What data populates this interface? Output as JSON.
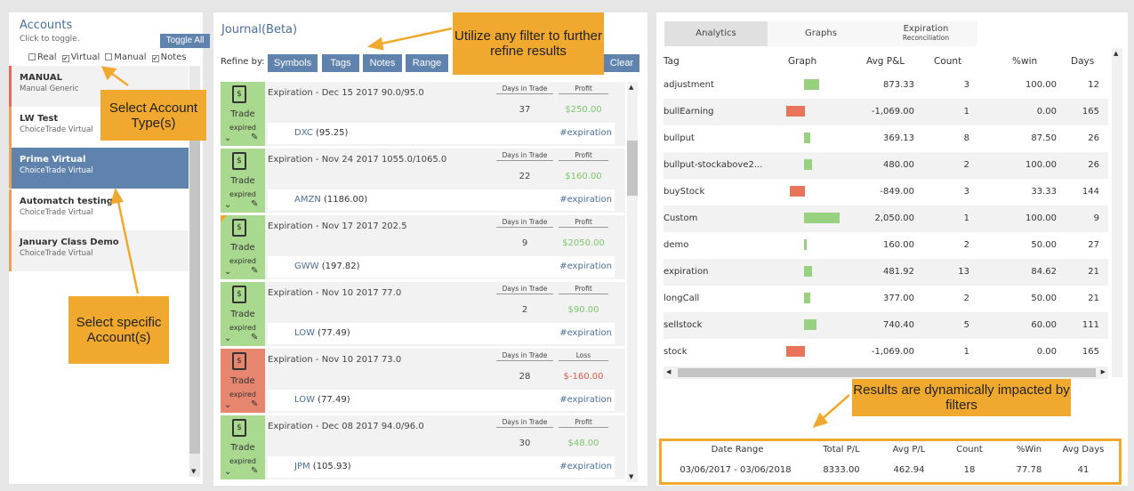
{
  "accounts": {
    "title": "Accounts",
    "subtitle": "Click to toggle.",
    "toggle_all": "Toggle All",
    "filters": [
      {
        "label": "Real",
        "checked": false
      },
      {
        "label": "Virtual",
        "checked": true
      },
      {
        "label": "Manual",
        "checked": false
      },
      {
        "label": "Notes",
        "checked": true
      }
    ],
    "items": [
      {
        "name": "MANUAL",
        "type": "Manual Generic"
      },
      {
        "name": "LW Test",
        "type": "ChoiceTrade Virtual"
      },
      {
        "name": "Prime Virtual",
        "type": "ChoiceTrade Virtual"
      },
      {
        "name": "Automatch testing",
        "type": "ChoiceTrade Virtual"
      },
      {
        "name": "January Class Demo",
        "type": "ChoiceTrade Virtual"
      }
    ]
  },
  "journal": {
    "title": "Journal(Beta)",
    "refine_label": "Refine by:",
    "filters": [
      "Symbols",
      "Tags",
      "Notes",
      "Range"
    ],
    "clear": "Clear",
    "days_label": "Days in Trade",
    "trades": [
      {
        "desc": "Expiration - Dec 15 2017 90.0/95.0",
        "days": "37",
        "pl_label": "Profit",
        "amount": "$250.00",
        "symbol": "DXC",
        "price": "(95.25)",
        "tag": "#expiration",
        "status": "Trade",
        "sub": "expired",
        "result": "profit"
      },
      {
        "desc": "Expiration - Nov 24 2017 1055.0/1065.0",
        "days": "22",
        "pl_label": "Profit",
        "amount": "$160.00",
        "symbol": "AMZN",
        "price": "(1186.00)",
        "tag": "#expiration",
        "status": "Trade",
        "sub": "expired",
        "result": "profit"
      },
      {
        "desc": "Expiration - Nov 17 2017 202.5",
        "days": "9",
        "pl_label": "Profit",
        "amount": "$2050.00",
        "symbol": "GWW",
        "price": "(197.82)",
        "tag": "#expiration",
        "status": "Trade",
        "sub": "expired",
        "result": "profit"
      },
      {
        "desc": "Expiration - Nov 10 2017 77.0",
        "days": "2",
        "pl_label": "Profit",
        "amount": "$90.00",
        "symbol": "LOW",
        "price": "(77.49)",
        "tag": "#expiration",
        "status": "Trade",
        "sub": "expired",
        "result": "profit"
      },
      {
        "desc": "Expiration - Nov 10 2017 73.0",
        "days": "28",
        "pl_label": "Loss",
        "amount": "$-160.00",
        "symbol": "LOW",
        "price": "(77.49)",
        "tag": "#expiration",
        "status": "Trade",
        "sub": "expired",
        "result": "loss"
      },
      {
        "desc": "Expiration - Dec 08 2017 94.0/96.0",
        "days": "30",
        "pl_label": "Profit",
        "amount": "$48.00",
        "symbol": "JPM",
        "price": "(105.93)",
        "tag": "#expiration",
        "status": "Trade",
        "sub": "expired",
        "result": "profit"
      }
    ]
  },
  "analytics": {
    "tabs": [
      "Analytics",
      "Graphs",
      "Expiration",
      "Reconciliation"
    ],
    "columns": [
      "Tag",
      "Graph",
      "Avg P&L",
      "Count",
      "%win",
      "Days"
    ],
    "rows": [
      {
        "tag": "adjustment",
        "avg": "873.33",
        "count": "3",
        "win": "100.00",
        "days": "12",
        "val": 873.33
      },
      {
        "tag": "bullEarning",
        "avg": "-1,069.00",
        "count": "1",
        "win": "0.00",
        "days": "165",
        "val": -1069
      },
      {
        "tag": "bullput",
        "avg": "369.13",
        "count": "8",
        "win": "87.50",
        "days": "26",
        "val": 369.13
      },
      {
        "tag": "bullput-stockabove2...",
        "avg": "480.00",
        "count": "2",
        "win": "100.00",
        "days": "26",
        "val": 480
      },
      {
        "tag": "buyStock",
        "avg": "-849.00",
        "count": "3",
        "win": "33.33",
        "days": "144",
        "val": -849
      },
      {
        "tag": "Custom",
        "avg": "2,050.00",
        "count": "1",
        "win": "100.00",
        "days": "9",
        "val": 2050
      },
      {
        "tag": "demo",
        "avg": "160.00",
        "count": "2",
        "win": "50.00",
        "days": "27",
        "val": 160
      },
      {
        "tag": "expiration",
        "avg": "481.92",
        "count": "13",
        "win": "84.62",
        "days": "21",
        "val": 481.92
      },
      {
        "tag": "longCall",
        "avg": "377.00",
        "count": "2",
        "win": "50.00",
        "days": "21",
        "val": 377
      },
      {
        "tag": "sellstock",
        "avg": "740.40",
        "count": "5",
        "win": "60.00",
        "days": "111",
        "val": 740.4
      },
      {
        "tag": "stock",
        "avg": "-1,069.00",
        "count": "1",
        "win": "0.00",
        "days": "165",
        "val": -1069
      }
    ],
    "summary": {
      "headers": [
        "Date Range",
        "Total P/L",
        "Avg P/L",
        "Count",
        "%Win",
        "Avg Days"
      ],
      "values": [
        "03/06/2017 - 03/06/2018",
        "8333.00",
        "462.94",
        "18",
        "77.78",
        "41"
      ]
    }
  },
  "callouts": {
    "filter": "Utilize any filter to further refine results",
    "account_type": "Select Account Type(s)",
    "account": "Select specific Account(s)",
    "results": "Results are dynamically impacted by filters"
  },
  "colors": {
    "accent": "#5f83ad",
    "callout": "#f1a82e",
    "profit": "#7cc76b",
    "loss": "#e0584a",
    "bar_pos": "#98d280",
    "bar_neg": "#e8755a"
  }
}
